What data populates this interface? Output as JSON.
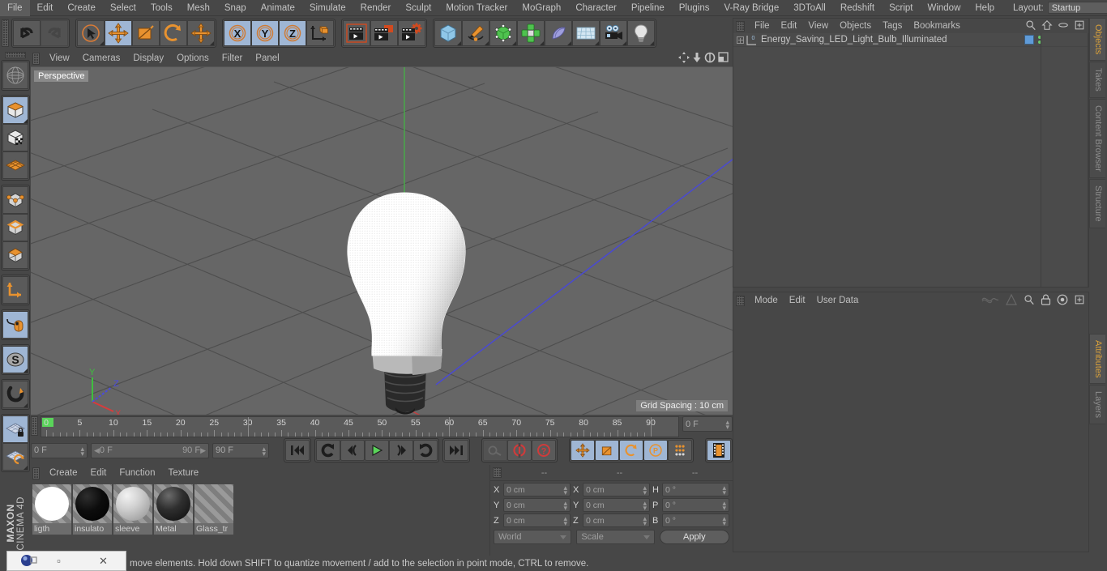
{
  "app": {
    "brand_line1": "MAXON",
    "brand_line2": "CINEMA 4D"
  },
  "menubar": {
    "items": [
      {
        "label": "File"
      },
      {
        "label": "Edit"
      },
      {
        "label": "Create"
      },
      {
        "label": "Select"
      },
      {
        "label": "Tools"
      },
      {
        "label": "Mesh"
      },
      {
        "label": "Snap"
      },
      {
        "label": "Animate"
      },
      {
        "label": "Simulate"
      },
      {
        "label": "Render"
      },
      {
        "label": "Sculpt"
      },
      {
        "label": "Motion Tracker"
      },
      {
        "label": "MoGraph"
      },
      {
        "label": "Character"
      },
      {
        "label": "Pipeline"
      },
      {
        "label": "Plugins"
      },
      {
        "label": "V-Ray Bridge"
      },
      {
        "label": "3DToAll"
      },
      {
        "label": "Redshift"
      },
      {
        "label": "Script"
      },
      {
        "label": "Window"
      },
      {
        "label": "Help"
      }
    ],
    "layout_label": "Layout:",
    "layout_value": "Startup",
    "icons": [
      "search-icon",
      "home-icon"
    ]
  },
  "toolbar": {
    "groups": [
      {
        "name": "history",
        "buttons": [
          {
            "name": "undo-button",
            "icon": "undo-arrow",
            "state": "normal"
          },
          {
            "name": "redo-button",
            "icon": "redo-arrow",
            "state": "disabled"
          }
        ]
      },
      {
        "name": "tools",
        "buttons": [
          {
            "name": "live-selection-tool",
            "icon": "cursor-circle",
            "state": "normal"
          },
          {
            "name": "move-tool",
            "icon": "move-arrows",
            "state": "active"
          },
          {
            "name": "scale-tool",
            "icon": "scale-box",
            "state": "normal"
          },
          {
            "name": "rotate-tool",
            "icon": "rotate-arc",
            "state": "normal"
          },
          {
            "name": "transform-tool",
            "icon": "move-arrows",
            "state": "normal"
          }
        ]
      },
      {
        "name": "axis-locks",
        "buttons": [
          {
            "name": "lock-x-axis-button",
            "icon": "x-axis",
            "state": "active"
          },
          {
            "name": "lock-y-axis-button",
            "icon": "y-axis",
            "state": "active"
          },
          {
            "name": "lock-z-axis-button",
            "icon": "z-axis",
            "state": "active"
          },
          {
            "name": "world-object-coordinates-button",
            "icon": "axis-cube",
            "state": "normal"
          }
        ]
      },
      {
        "name": "render",
        "buttons": [
          {
            "name": "render-view-button",
            "icon": "clapper-view",
            "state": "normal"
          },
          {
            "name": "render-to-picture-viewer-button",
            "icon": "clapper-picture",
            "state": "normal"
          },
          {
            "name": "render-settings-button",
            "icon": "clapper-gear",
            "state": "normal"
          }
        ]
      },
      {
        "name": "creation",
        "buttons": [
          {
            "name": "add-cube-button",
            "icon": "blue-cube",
            "state": "normal"
          },
          {
            "name": "add-spline-button",
            "icon": "pen-spline",
            "state": "normal"
          },
          {
            "name": "nurbs-button",
            "icon": "green-cube-points",
            "state": "normal"
          },
          {
            "name": "array-button",
            "icon": "green-cluster",
            "state": "normal"
          },
          {
            "name": "bend-deformer-button",
            "icon": "purple-bend",
            "state": "normal"
          },
          {
            "name": "floor-environment-button",
            "icon": "grid-plane",
            "state": "normal"
          },
          {
            "name": "camera-button",
            "icon": "camera",
            "state": "normal"
          },
          {
            "name": "light-button",
            "icon": "light-bulb",
            "state": "normal"
          }
        ]
      }
    ]
  },
  "left_toolbar": {
    "groups": [
      {
        "buttons": [
          {
            "name": "undo-view-button",
            "icon": "globe-wire",
            "state": "normal"
          }
        ]
      },
      {
        "buttons": [
          {
            "name": "model-mode-button",
            "icon": "cube-model",
            "state": "active"
          },
          {
            "name": "texture-mode-button",
            "icon": "cube-checker",
            "state": "normal"
          },
          {
            "name": "workplane-mode-button",
            "icon": "orange-grid",
            "state": "normal"
          }
        ]
      },
      {
        "buttons": [
          {
            "name": "points-mode-button",
            "icon": "cube-points",
            "state": "normal"
          },
          {
            "name": "edges-mode-button",
            "icon": "cube-edges",
            "state": "normal"
          },
          {
            "name": "polygons-mode-button",
            "icon": "cube-polygons",
            "state": "normal"
          }
        ]
      },
      {
        "buttons": [
          {
            "name": "enable-axis-modification-button",
            "icon": "axis-l",
            "state": "normal"
          }
        ]
      },
      {
        "buttons": [
          {
            "name": "viewport-solo-button",
            "icon": "mouse-curve",
            "state": "active"
          }
        ]
      },
      {
        "buttons": [
          {
            "name": "enable-snapping-button",
            "icon": "s-circle",
            "state": "active"
          }
        ]
      },
      {
        "buttons": [
          {
            "name": "magnet-tool-button",
            "icon": "magnet",
            "state": "normal"
          }
        ]
      },
      {
        "buttons": [
          {
            "name": "lock-workplane-button",
            "icon": "grid-lock",
            "state": "active"
          },
          {
            "name": "planar-workplane-button",
            "icon": "grid-rotate",
            "state": "normal"
          }
        ]
      }
    ]
  },
  "viewport": {
    "menu": [
      {
        "label": "View"
      },
      {
        "label": "Cameras"
      },
      {
        "label": "Display"
      },
      {
        "label": "Options"
      },
      {
        "label": "Filter"
      },
      {
        "label": "Panel"
      }
    ],
    "corner_icons": [
      "pan-icon",
      "zoom-icon",
      "rotate-icon",
      "maximize-icon"
    ],
    "label": "Perspective",
    "grid_spacing": "Grid Spacing : 10 cm",
    "axis_labels": {
      "x": "X",
      "y": "Y",
      "z": "Z"
    },
    "axis_colors": {
      "x": "#d64444",
      "y": "#4fc24f",
      "z": "#4a5fd6"
    },
    "background": "#666666",
    "object": "Energy Saving LED Light Bulb"
  },
  "timeline": {
    "ruler_labels": [
      "0",
      "5",
      "10",
      "15",
      "20",
      "25",
      "30",
      "35",
      "40",
      "45",
      "50",
      "55",
      "60",
      "65",
      "70",
      "75",
      "80",
      "85",
      "90"
    ],
    "ruler_min": 0,
    "ruler_max": 90,
    "marked_frames": [
      30,
      60,
      90
    ],
    "current_frame_field": "0 F",
    "preview_start": "0 F",
    "preview_end": "90 F",
    "max_frame_field": "90 F",
    "end_frame_field": "0 F",
    "playback_buttons": [
      {
        "name": "go-to-start-button",
        "icon": "skip-start"
      },
      {
        "name": "play-backwards-loop-button",
        "icon": "loop-back"
      },
      {
        "name": "go-to-previous-frame-button",
        "icon": "step-back"
      },
      {
        "name": "play-forward-button",
        "icon": "play",
        "color": "#5ad45a"
      },
      {
        "name": "go-to-next-frame-button",
        "icon": "step-forward"
      },
      {
        "name": "play-forwards-loop-button",
        "icon": "loop-forward"
      },
      {
        "name": "go-to-end-button",
        "icon": "skip-end"
      }
    ],
    "record_buttons": [
      {
        "name": "autokeying-button",
        "icon": "key",
        "state": "disabled"
      },
      {
        "name": "record-active-objects-button",
        "icon": "record-red"
      },
      {
        "name": "keyframe-selection-button",
        "icon": "question-red"
      }
    ],
    "key_toggle_buttons": [
      {
        "name": "position-key-button",
        "icon": "move-arrows",
        "state": "active"
      },
      {
        "name": "scale-key-button",
        "icon": "scale-box",
        "state": "active"
      },
      {
        "name": "rotation-key-button",
        "icon": "rotate-arc",
        "state": "active"
      },
      {
        "name": "parameter-key-button",
        "icon": "p-circle",
        "state": "active"
      },
      {
        "name": "point-level-animation-button",
        "icon": "dot-matrix",
        "state": "active"
      }
    ],
    "timeline_toggle": {
      "name": "animation-layers-button",
      "icon": "filmstrip",
      "state": "active"
    }
  },
  "material_manager": {
    "menu": [
      {
        "label": "Create"
      },
      {
        "label": "Edit"
      },
      {
        "label": "Function"
      },
      {
        "label": "Texture"
      }
    ],
    "materials": [
      {
        "name": "ligth",
        "color": "#ffffff",
        "shade": "flat-white"
      },
      {
        "name": "insulato",
        "color": "#0a0a0a",
        "shade": "black-gloss"
      },
      {
        "name": "sleeve",
        "color": "#b5b5b5",
        "shade": "grey-gloss"
      },
      {
        "name": "Metal",
        "color": "#2a2a2a",
        "shade": "dark-metal"
      },
      {
        "name": "Glass_tr",
        "color": "transparent",
        "shade": "transparent"
      }
    ]
  },
  "coordinates": {
    "header_dashes": [
      "--",
      "--",
      "--"
    ],
    "position": {
      "label_x": "X",
      "label_y": "Y",
      "label_z": "Z",
      "x": "0 cm",
      "y": "0 cm",
      "z": "0 cm"
    },
    "size": {
      "label_x": "X",
      "label_y": "Y",
      "label_z": "Z",
      "x": "0 cm",
      "y": "0 cm",
      "z": "0 cm"
    },
    "rotation": {
      "label_h": "H",
      "label_p": "P",
      "label_b": "B",
      "h": "0 °",
      "p": "0 °",
      "b": "0 °"
    },
    "coord_system": "World",
    "transform_mode": "Scale",
    "apply_label": "Apply"
  },
  "object_manager": {
    "menu": [
      {
        "label": "File"
      },
      {
        "label": "Edit"
      },
      {
        "label": "View"
      },
      {
        "label": "Objects"
      },
      {
        "label": "Tags"
      },
      {
        "label": "Bookmarks"
      }
    ],
    "header_icons": [
      "search-icon",
      "home-icon",
      "ellipse-icon",
      "plus-box-icon"
    ],
    "rows": [
      {
        "name": "Energy_Saving_LED_Light_Bulb_Illuminated",
        "expandable": true,
        "icon": "null-object-icon",
        "tags": [
          "texture-tag",
          "visibility-dots"
        ]
      }
    ]
  },
  "attribute_manager": {
    "menu": [
      {
        "label": "Mode"
      },
      {
        "label": "Edit"
      },
      {
        "label": "User Data"
      }
    ],
    "header_icons": [
      "wave-icon",
      "cone-icon",
      "search-icon",
      "lock-icon",
      "target-icon",
      "plus-box-icon"
    ]
  },
  "right_tabs": {
    "top": [
      {
        "label": "Objects",
        "active": true
      },
      {
        "label": "Takes",
        "active": false
      },
      {
        "label": "Content Browser",
        "active": false
      },
      {
        "label": "Structure",
        "active": false
      }
    ],
    "bottom": [
      {
        "label": "Attributes",
        "active": true
      },
      {
        "label": "Layers",
        "active": false
      }
    ]
  },
  "statusbar": {
    "text": "move elements. Hold down SHIFT to quantize movement / add to the selection in point mode, CTRL to remove."
  },
  "taskbar_window": {
    "app_icon": "c4d-logo-icon",
    "minimize": "▫",
    "close": "✕"
  },
  "colors": {
    "chrome": "#474747",
    "panel": "#4b4b4b",
    "accent_blue": "#9fb6d4",
    "accent_orange": "#d9a13b",
    "viewport_bg": "#666666"
  }
}
